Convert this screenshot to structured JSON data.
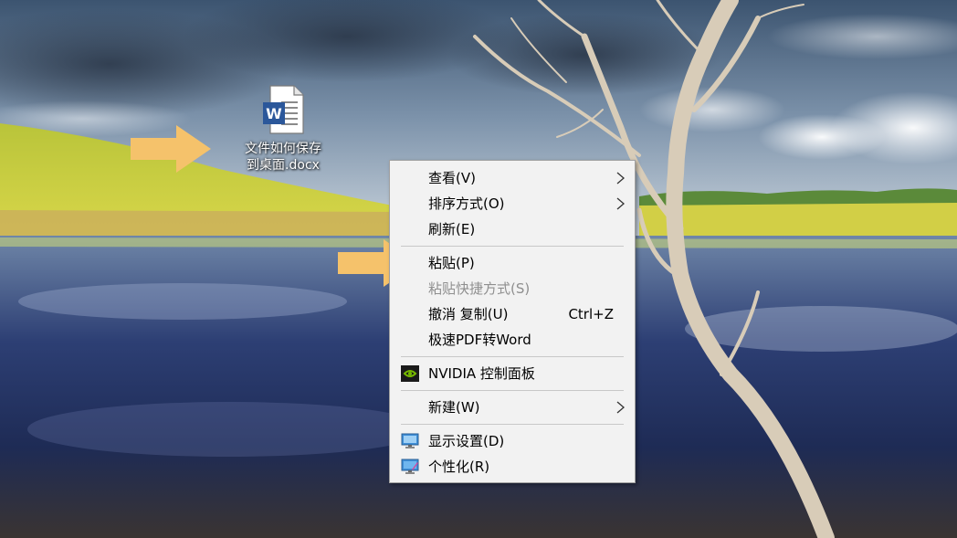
{
  "desktop": {
    "icon": {
      "label_line1": "文件如何保存",
      "label_line2": "到桌面.docx",
      "badge": "W",
      "icon": "word-document-icon"
    }
  },
  "context_menu": {
    "items": [
      {
        "label": "查看(V)",
        "submenu": true
      },
      {
        "label": "排序方式(O)",
        "submenu": true
      },
      {
        "label": "刷新(E)"
      },
      {
        "label": "粘贴(P)"
      },
      {
        "label": "粘贴快捷方式(S)",
        "disabled": true
      },
      {
        "label": "撤消 复制(U)",
        "shortcut": "Ctrl+Z"
      },
      {
        "label": "极速PDF转Word"
      },
      {
        "label": "NVIDIA 控制面板",
        "icon": "nvidia-icon"
      },
      {
        "label": "新建(W)",
        "submenu": true
      },
      {
        "label": "显示设置(D)",
        "icon": "display-icon"
      },
      {
        "label": "个性化(R)",
        "icon": "personalize-icon"
      }
    ]
  },
  "colors": {
    "accent_arrow": "#f5c26b",
    "menu_background": "#f2f2f2",
    "word_blue": "#2b579a"
  }
}
